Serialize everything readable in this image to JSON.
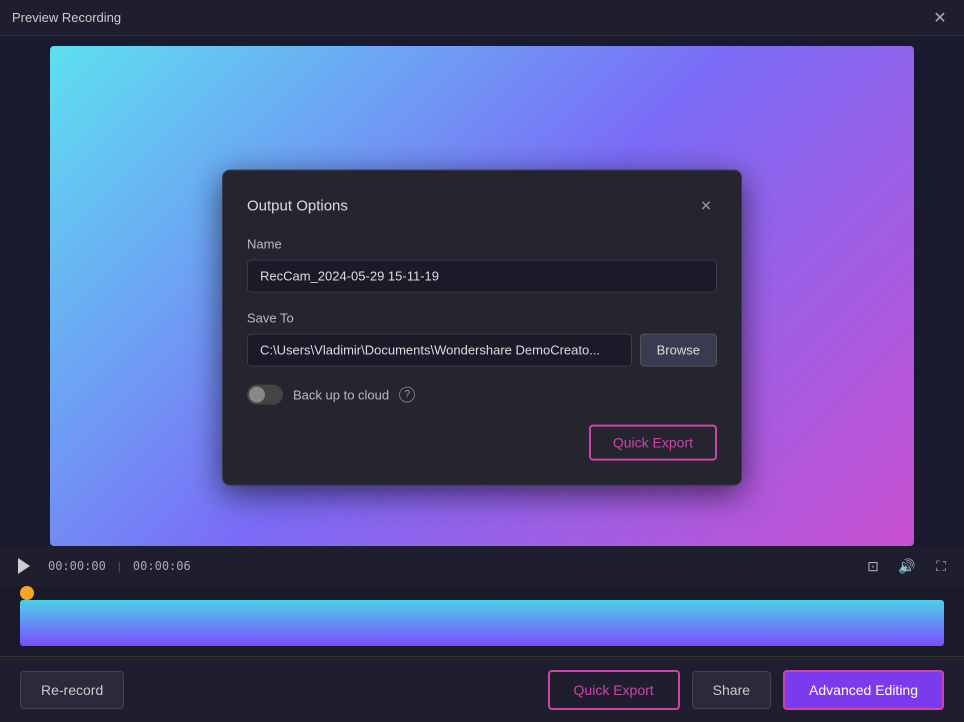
{
  "titleBar": {
    "title": "Preview Recording"
  },
  "dialog": {
    "title": "Output Options",
    "nameLabel": "Name",
    "nameValue": "RecCam_2024-05-29 15-11-19",
    "saveToLabel": "Save To",
    "saveToPath": "C:\\Users\\Vladimir\\Documents\\Wondershare DemoCreato...",
    "browseLabel": "Browse",
    "cloudLabel": "Back up to cloud",
    "quickExportLabel": "Quick Export"
  },
  "controls": {
    "currentTime": "00:00:00",
    "totalTime": "00:00:06"
  },
  "bottomBar": {
    "rerecordLabel": "Re-record",
    "quickExportLabel": "Quick Export",
    "shareLabel": "Share",
    "advancedEditingLabel": "Advanced Editing"
  },
  "icons": {
    "close": "✕",
    "play": "▶",
    "crop": "⊡",
    "volume": "🔊",
    "fullscreen": "⛶",
    "help": "?"
  }
}
